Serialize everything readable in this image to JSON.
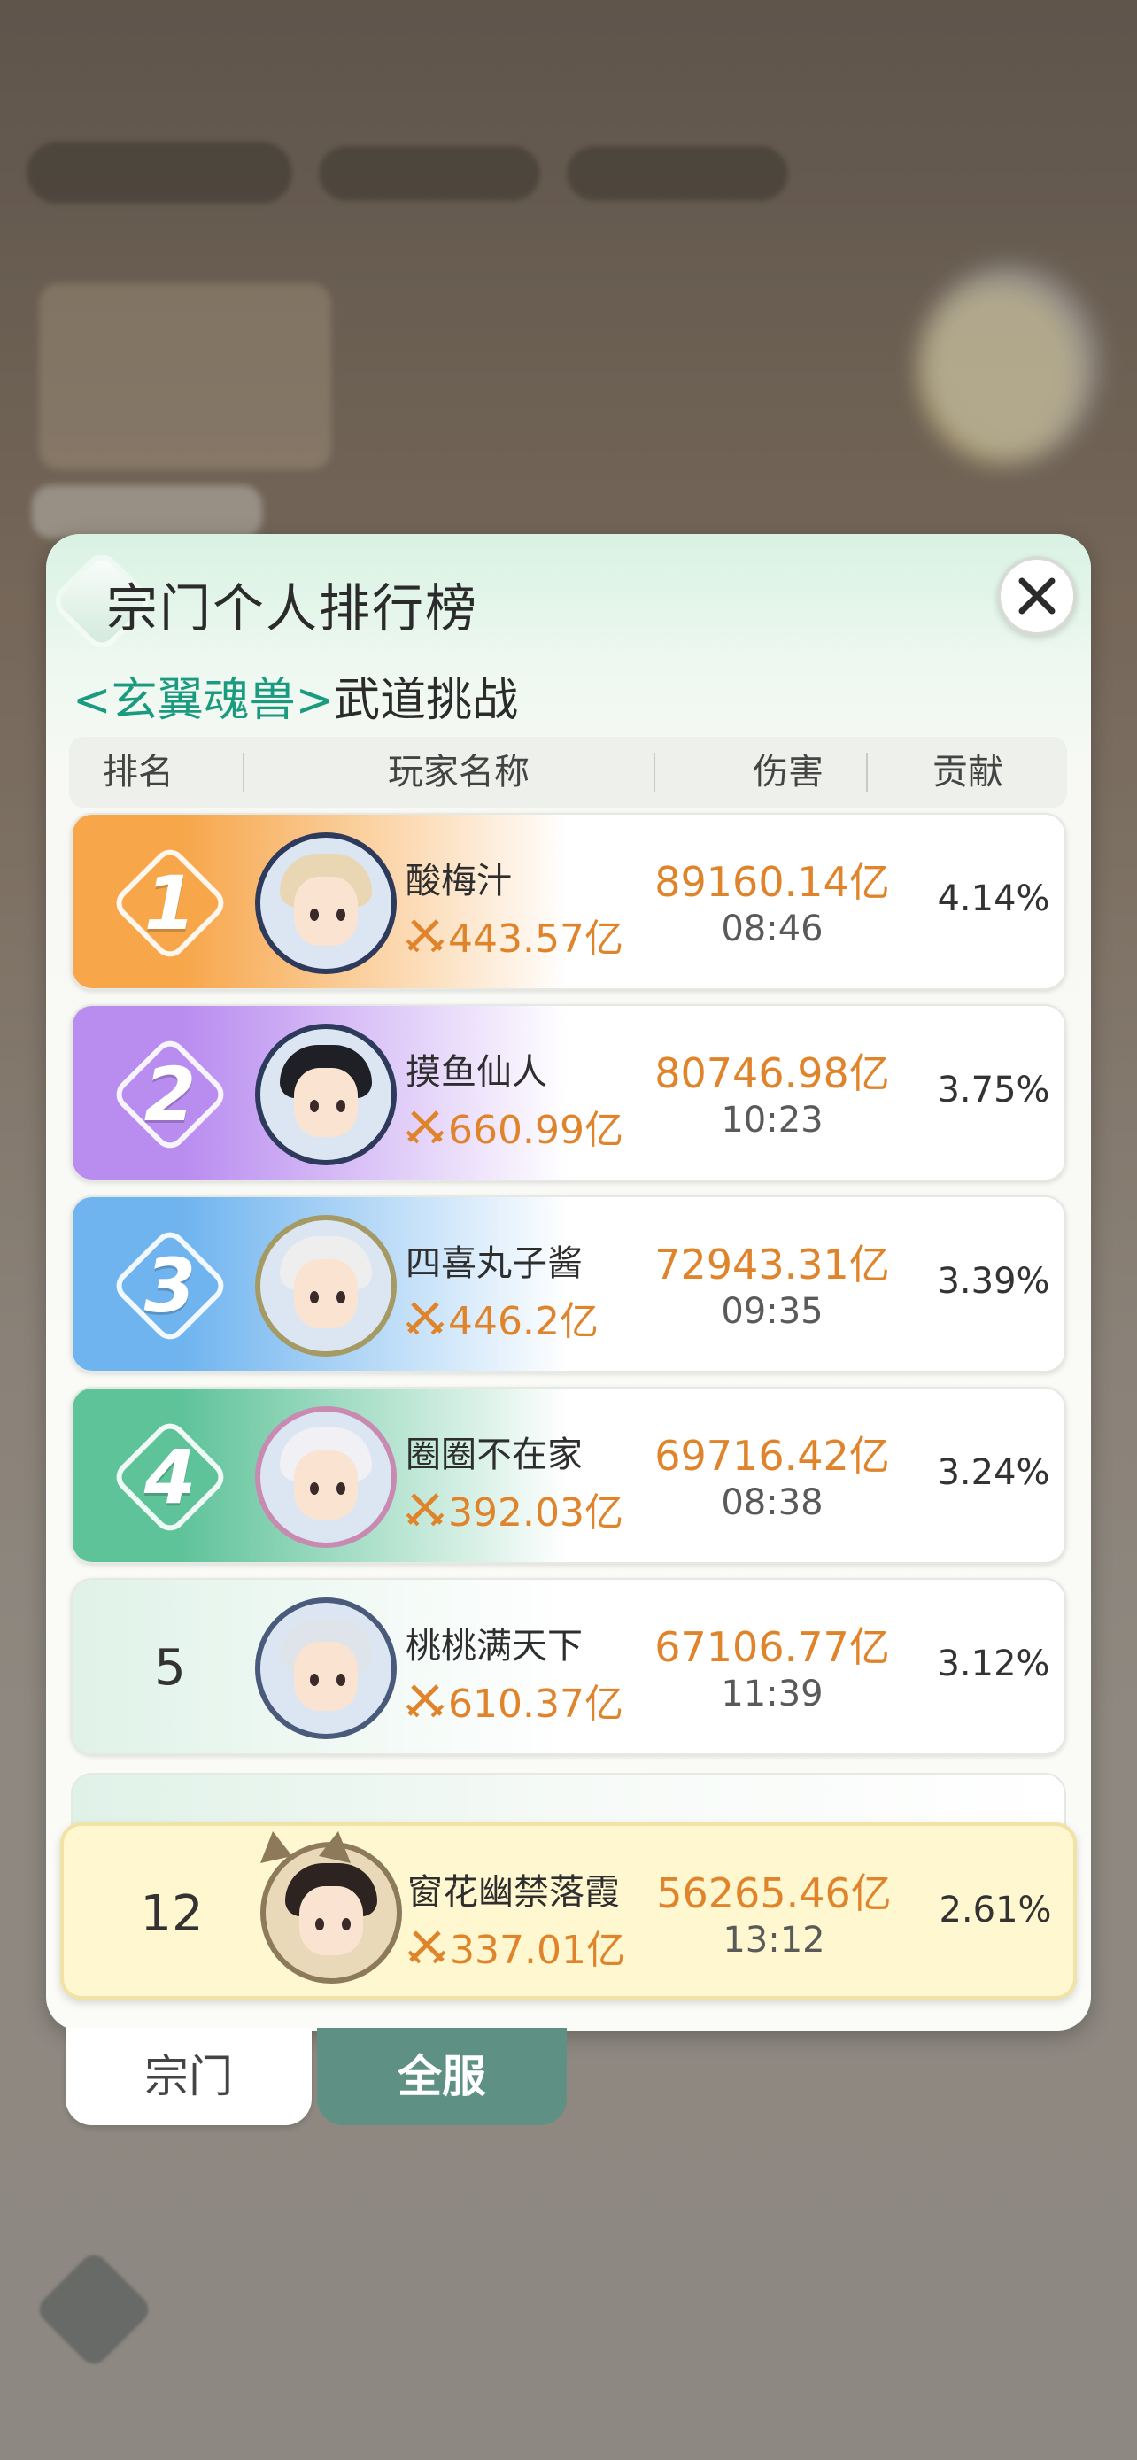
{
  "panel": {
    "title": "宗门个人排行榜",
    "subtitle_boss": "<玄翼魂兽>",
    "subtitle_event": "武道挑战",
    "close_icon": "close-icon"
  },
  "table": {
    "headers": [
      "排名",
      "玩家名称",
      "伤害",
      "贡献"
    ],
    "rows": [
      {
        "rank": "1",
        "name": "酸梅汁",
        "power": "443.57亿",
        "damage": "89160.14亿",
        "time": "08:46",
        "contrib": "4.14%",
        "color": "#f7a64a"
      },
      {
        "rank": "2",
        "name": "摸鱼仙人",
        "power": "660.99亿",
        "damage": "80746.98亿",
        "time": "10:23",
        "contrib": "3.75%",
        "color": "#b98cf0"
      },
      {
        "rank": "3",
        "name": "四喜丸子酱",
        "power": "446.2亿",
        "damage": "72943.31亿",
        "time": "09:35",
        "contrib": "3.39%",
        "color": "#6fb4ef"
      },
      {
        "rank": "4",
        "name": "圈圈不在家",
        "power": "392.03亿",
        "damage": "69716.42亿",
        "time": "08:38",
        "contrib": "3.24%",
        "color": "#5fc39a"
      },
      {
        "rank": "5",
        "name": "桃桃满天下",
        "power": "610.37亿",
        "damage": "67106.77亿",
        "time": "11:39",
        "contrib": "3.12%",
        "color": "#dff2e8"
      }
    ]
  },
  "self": {
    "rank": "12",
    "name": "窗花幽禁落霞",
    "power": "337.01亿",
    "damage": "56265.46亿",
    "time": "13:12",
    "contrib": "2.61%"
  },
  "tabs": {
    "sect": "宗门",
    "all_server": "全服"
  }
}
